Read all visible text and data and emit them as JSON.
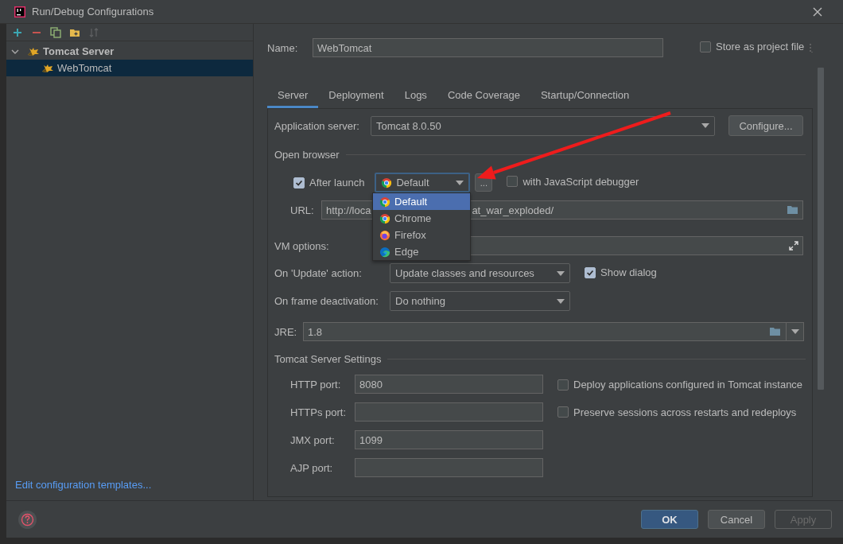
{
  "window": {
    "title": "Run/Debug Configurations"
  },
  "tree": [
    {
      "label": "Tomcat Server",
      "expanded": true,
      "selected": false,
      "children": [
        {
          "label": "WebTomcat",
          "selected": true
        }
      ]
    }
  ],
  "edit_templates_link": "Edit configuration templates...",
  "name": {
    "label": "Name:",
    "value": "WebTomcat"
  },
  "store_as_project_file": {
    "label": "Store as project file",
    "checked": false
  },
  "tabs": [
    {
      "label": "Server",
      "selected": true
    },
    {
      "label": "Deployment",
      "selected": false
    },
    {
      "label": "Logs",
      "selected": false
    },
    {
      "label": "Code Coverage",
      "selected": false
    },
    {
      "label": "Startup/Connection",
      "selected": false
    }
  ],
  "application_server": {
    "label": "Application server:",
    "value": "Tomcat 8.0.50"
  },
  "configure_button": "Configure...",
  "open_browser": {
    "title": "Open browser",
    "after_launch": {
      "label": "After launch",
      "checked": true
    },
    "browser": {
      "value": "Default",
      "kind": "chrome",
      "expanded": true
    },
    "more_button": "...",
    "js_debugger": {
      "label": "with JavaScript debugger",
      "checked": false
    },
    "browser_options": [
      {
        "label": "Default",
        "kind": "chrome",
        "selected": true
      },
      {
        "label": "Chrome",
        "kind": "chrome",
        "selected": false
      },
      {
        "label": "Firefox",
        "kind": "firefox",
        "selected": false
      },
      {
        "label": "Edge",
        "kind": "edge",
        "selected": false
      }
    ],
    "url": {
      "label": "URL:",
      "value_start": "http://loca",
      "value_end": "at_war_exploded/"
    }
  },
  "vm_options": {
    "label": "VM options:"
  },
  "on_update": {
    "label": "On 'Update' action:",
    "value": "Update classes and resources"
  },
  "show_dialog": {
    "label": "Show dialog",
    "checked": true
  },
  "on_frame_deactivation": {
    "label": "On frame deactivation:",
    "value": "Do nothing"
  },
  "jre": {
    "label": "JRE:",
    "value": "1.8"
  },
  "server_settings": {
    "title": "Tomcat Server Settings",
    "ports": [
      {
        "label": "HTTP port:",
        "value": "8080"
      },
      {
        "label": "HTTPs port:"
      },
      {
        "label": "JMX port:",
        "value": "1099"
      },
      {
        "label": "AJP port:"
      }
    ],
    "options": [
      {
        "label": "Deploy applications configured in Tomcat instance",
        "checked": false
      },
      {
        "label": "Preserve sessions across restarts and redeploys",
        "checked": false
      }
    ]
  },
  "buttons": [
    {
      "label": "OK",
      "default": true,
      "disabled": false
    },
    {
      "label": "Cancel",
      "default": false,
      "disabled": false
    },
    {
      "label": "Apply",
      "default": false,
      "disabled": true
    }
  ]
}
